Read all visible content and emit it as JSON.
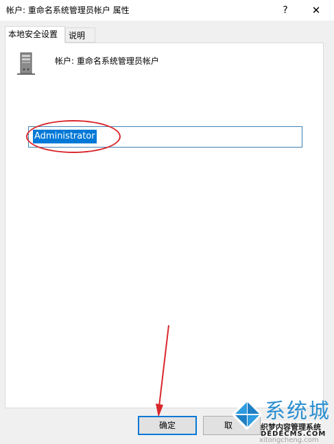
{
  "window": {
    "title": "帐户: 重命名系统管理员帐户 属性",
    "help_glyph": "?",
    "close_glyph": "✕"
  },
  "tabs": [
    {
      "label": "本地安全设置",
      "active": true
    },
    {
      "label": "说明",
      "active": false
    }
  ],
  "setting": {
    "icon": "server-icon",
    "label": "帐户: 重命名系统管理员帐户"
  },
  "account_name_input": {
    "value": "Administrator",
    "selected": true
  },
  "buttons": {
    "ok_label": "确定",
    "cancel_label": "取"
  },
  "annotation": {
    "color": "#d9262b"
  },
  "watermark": {
    "big_text": "系统城",
    "line1": "织梦内容管理系统",
    "line2": "DEDECMS.COM",
    "line3": "xitongcheng.com"
  },
  "colors": {
    "accent": "#0078d7",
    "annotation_red": "#d9262b"
  }
}
